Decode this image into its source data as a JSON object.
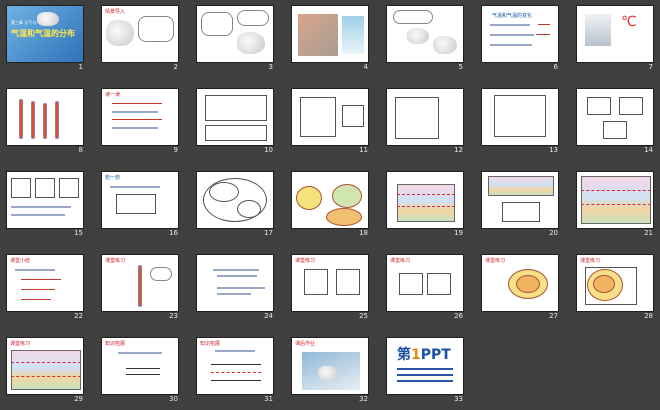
{
  "slides": [
    {
      "number": "1",
      "title": "气温和气温的分布",
      "subtitle": "第三章 天气与气候"
    },
    {
      "number": "2",
      "title": "情景导入"
    },
    {
      "number": "3",
      "title": ""
    },
    {
      "number": "4",
      "title": ""
    },
    {
      "number": "5",
      "title": ""
    },
    {
      "number": "6",
      "title": "气温和气温的变化"
    },
    {
      "number": "7",
      "title": "℃"
    },
    {
      "number": "8",
      "title": ""
    },
    {
      "number": "9",
      "title": "读一读"
    },
    {
      "number": "10",
      "title": ""
    },
    {
      "number": "11",
      "title": ""
    },
    {
      "number": "12",
      "title": ""
    },
    {
      "number": "13",
      "title": ""
    },
    {
      "number": "14",
      "title": ""
    },
    {
      "number": "15",
      "title": ""
    },
    {
      "number": "16",
      "title": "想一想"
    },
    {
      "number": "17",
      "title": ""
    },
    {
      "number": "18",
      "title": ""
    },
    {
      "number": "19",
      "title": ""
    },
    {
      "number": "20",
      "title": ""
    },
    {
      "number": "21",
      "title": ""
    },
    {
      "number": "22",
      "title": "课堂小结"
    },
    {
      "number": "23",
      "title": "课堂练习"
    },
    {
      "number": "24",
      "title": ""
    },
    {
      "number": "25",
      "title": "课堂练习"
    },
    {
      "number": "26",
      "title": "课堂练习"
    },
    {
      "number": "27",
      "title": "课堂练习"
    },
    {
      "number": "28",
      "title": "课堂练习"
    },
    {
      "number": "29",
      "title": "课堂练习"
    },
    {
      "number": "30",
      "title": "知识拓展"
    },
    {
      "number": "31",
      "title": "知识拓展"
    },
    {
      "number": "32",
      "title": "课后作业"
    },
    {
      "number": "33",
      "title": "第1PPT",
      "brand_prefix": "第",
      "brand_digit": "1",
      "brand_suffix": "PPT"
    }
  ]
}
